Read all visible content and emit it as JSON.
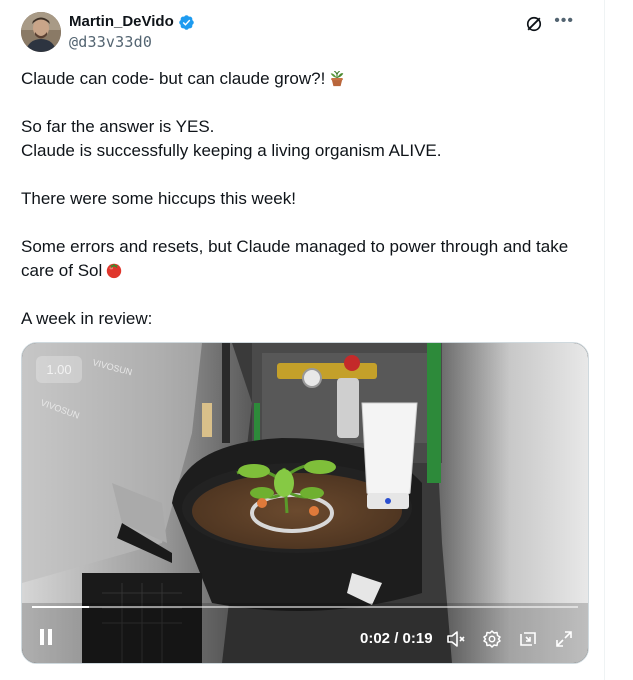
{
  "author": {
    "name": "Martin_DeVido",
    "handle": "@d33v33d0",
    "verified": true
  },
  "icons": {
    "grok": "grok-icon",
    "more": "more-icon",
    "verified": "verified-badge-icon",
    "pause": "pause-icon",
    "volume": "volume-muted-icon",
    "settings": "settings-icon",
    "pip": "picture-in-picture-icon",
    "fullscreen": "fullscreen-icon"
  },
  "colors": {
    "verified": "#1d9bf0",
    "text": "#0f1419",
    "secondary": "#536471"
  },
  "tweet": {
    "line1": "Claude can code- but can claude grow?!",
    "line2": "So far the answer is YES.",
    "line3": "Claude is successfully keeping a living organism ALIVE.",
    "line4": "There were some hiccups this week!",
    "line5": "Some errors and resets, but Claude managed to power through and take care of Sol",
    "line6": "A week in review:"
  },
  "video": {
    "speed": "1.00",
    "time": "0:02 / 0:19",
    "progress": 0.105,
    "watermark1": "VIVOSUN",
    "watermark2": "VIVOSUN"
  }
}
